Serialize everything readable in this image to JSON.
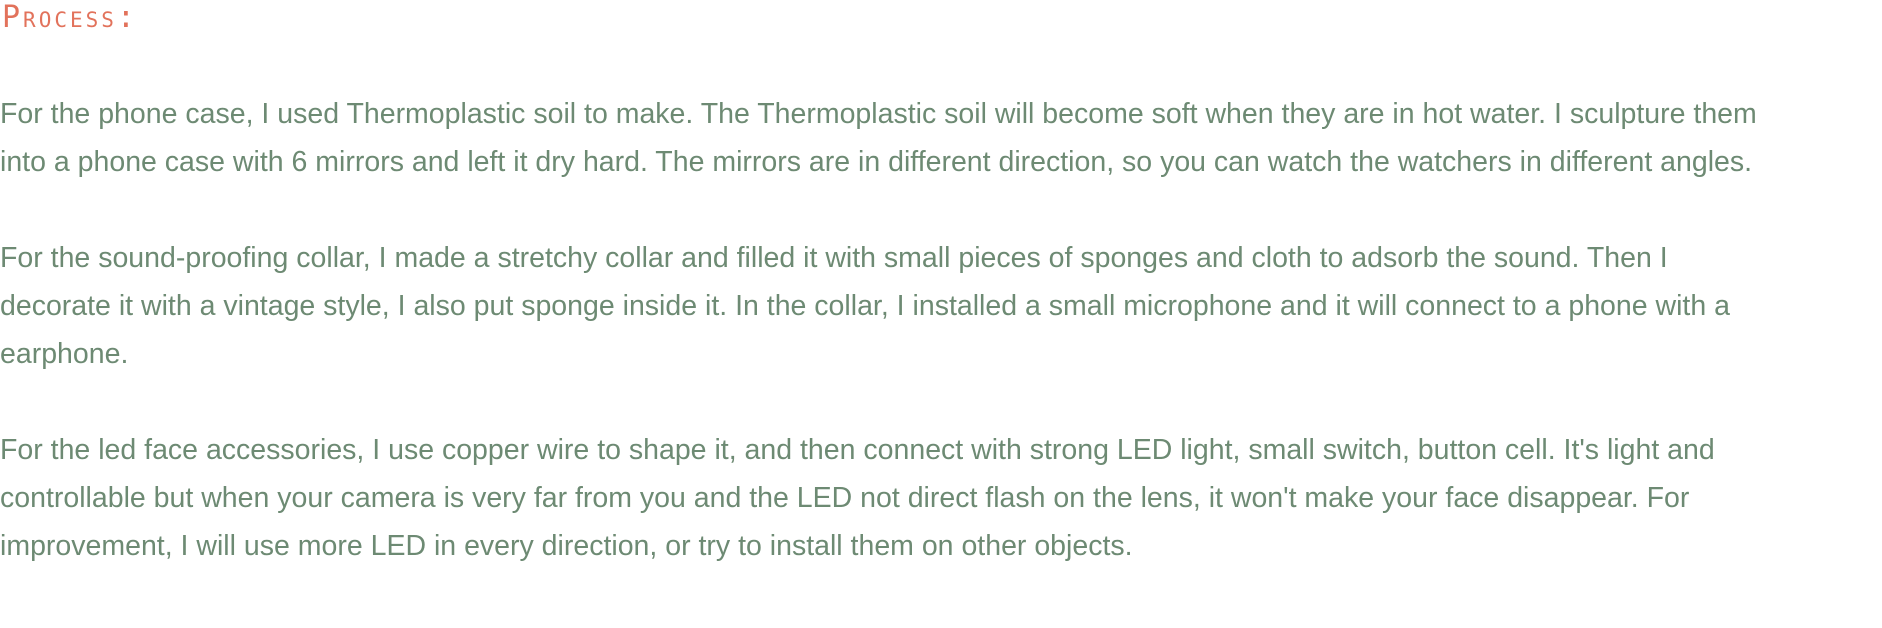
{
  "heading": "Process:",
  "paragraphs": [
    {
      "lines": [
        "For the phone case, I used Thermoplastic soil to make. The Thermoplastic soil will become soft when they are in hot water. I sculpture them",
        "into a phone case with 6 mirrors and left it dry hard. The mirrors are in different direction, so you can watch the watchers in different angles."
      ]
    },
    {
      "lines": [
        "For the sound-proofing collar, I made a stretchy collar and filled it with small pieces of sponges and cloth to adsorb the sound. Then I",
        "decorate it with a vintage style, I also put sponge inside it. In the collar, I installed a small microphone and it will connect to a phone with a",
        "earphone."
      ]
    },
    {
      "lines": [
        "For the led face accessories, I use copper wire to shape it, and then connect with strong LED light, small switch, button cell. It's light and",
        "controllable but when your camera is very far from you and the LED not direct flash on the lens, it won't make your face disappear. For",
        "improvement, I will use more LED in every direction, or try to install them on other objects."
      ]
    }
  ],
  "colors": {
    "heading": "#e2725b",
    "body_text": "#6d8a73",
    "background": "#ffffff"
  }
}
